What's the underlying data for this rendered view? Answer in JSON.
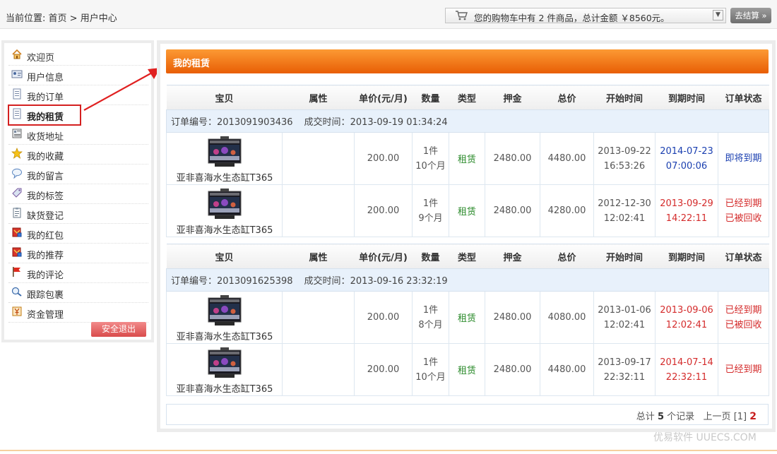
{
  "breadcrumb": {
    "prefix": "当前位置: ",
    "home": "首页",
    "sep": " > ",
    "current": "用户中心"
  },
  "cart": {
    "text": "您的购物车中有 2 件商品，总计金额 ￥8560元。",
    "checkout_label": "去结算 »"
  },
  "sidebar": {
    "items": [
      {
        "label": "欢迎页",
        "icon": "home-icon"
      },
      {
        "label": "用户信息",
        "icon": "user-card-icon"
      },
      {
        "label": "我的订单",
        "icon": "document-icon"
      },
      {
        "label": "我的租赁",
        "icon": "document-icon"
      },
      {
        "label": "收货地址",
        "icon": "address-book-icon"
      },
      {
        "label": "我的收藏",
        "icon": "star-icon"
      },
      {
        "label": "我的留言",
        "icon": "speech-bubble-icon"
      },
      {
        "label": "我的标签",
        "icon": "tag-icon"
      },
      {
        "label": "缺货登记",
        "icon": "clipboard-icon"
      },
      {
        "label": "我的红包",
        "icon": "red-envelope-icon"
      },
      {
        "label": "我的推荐",
        "icon": "red-envelope-icon"
      },
      {
        "label": "我的评论",
        "icon": "flag-icon"
      },
      {
        "label": "跟踪包裹",
        "icon": "tracking-icon"
      },
      {
        "label": "资金管理",
        "icon": "wallet-icon"
      }
    ],
    "active_index": 3,
    "logout_label": "安全退出"
  },
  "main": {
    "title": "我的租赁",
    "columns": [
      "宝贝",
      "属性",
      "单价(元/月)",
      "数量",
      "类型",
      "押金",
      "总价",
      "开始时间",
      "到期时间",
      "订单状态"
    ],
    "order_label": "订单编号：",
    "time_label": "成交时间：",
    "orders": [
      {
        "order_no": "2013091903436",
        "deal_time": "2013-09-19 01:34:24",
        "rows": [
          {
            "product": "亚非喜海水生态缸T365",
            "attr": "",
            "price": "200.00",
            "qty": "1件",
            "duration": "10个月",
            "type": "租赁",
            "deposit": "2480.00",
            "total": "4480.00",
            "start_date": "2013-09-22",
            "start_time": "16:53:26",
            "end_date": "2014-07-23",
            "end_time": "07:00:06",
            "end_color": "#1a3fb0",
            "status": [
              "即将到期"
            ],
            "status_color": "#1a3fb0"
          },
          {
            "product": "亚非喜海水生态缸T365",
            "attr": "",
            "price": "200.00",
            "qty": "1件",
            "duration": "9个月",
            "type": "租赁",
            "deposit": "2480.00",
            "total": "4280.00",
            "start_date": "2012-12-30",
            "start_time": "12:02:41",
            "end_date": "2013-09-29",
            "end_time": "14:22:11",
            "end_color": "#d42b2b",
            "status": [
              "已经到期",
              "已被回收"
            ],
            "status_color": "#d42b2b"
          }
        ]
      },
      {
        "order_no": "2013091625398",
        "deal_time": "2013-09-16 23:32:19",
        "rows": [
          {
            "product": "亚非喜海水生态缸T365",
            "attr": "",
            "price": "200.00",
            "qty": "1件",
            "duration": "8个月",
            "type": "租赁",
            "deposit": "2480.00",
            "total": "4080.00",
            "start_date": "2013-01-06",
            "start_time": "12:02:41",
            "end_date": "2013-09-06",
            "end_time": "12:02:41",
            "end_color": "#d42b2b",
            "status": [
              "已经到期",
              "已被回收"
            ],
            "status_color": "#d42b2b"
          },
          {
            "product": "亚非喜海水生态缸T365",
            "attr": "",
            "price": "200.00",
            "qty": "1件",
            "duration": "10个月",
            "type": "租赁",
            "deposit": "2480.00",
            "total": "4480.00",
            "start_date": "2013-09-17",
            "start_time": "22:32:11",
            "end_date": "2014-07-14",
            "end_time": "22:32:11",
            "end_color": "#d42b2b",
            "status": [
              "已经到期"
            ],
            "status_color": "#d42b2b"
          }
        ]
      }
    ]
  },
  "pager": {
    "total_prefix": "总计 ",
    "total_count": "5",
    "total_suffix": " 个记录",
    "prev_label": "上一页",
    "page1": "[1]",
    "page2": "2"
  },
  "watermark": "优易软件 UUECS.COM",
  "colors": {
    "accent_orange": "#f07818",
    "active_outline": "#d42020",
    "expired_red": "#d42b2b",
    "soon_blue": "#1a3fb0",
    "type_green": "#2a8a2a"
  }
}
